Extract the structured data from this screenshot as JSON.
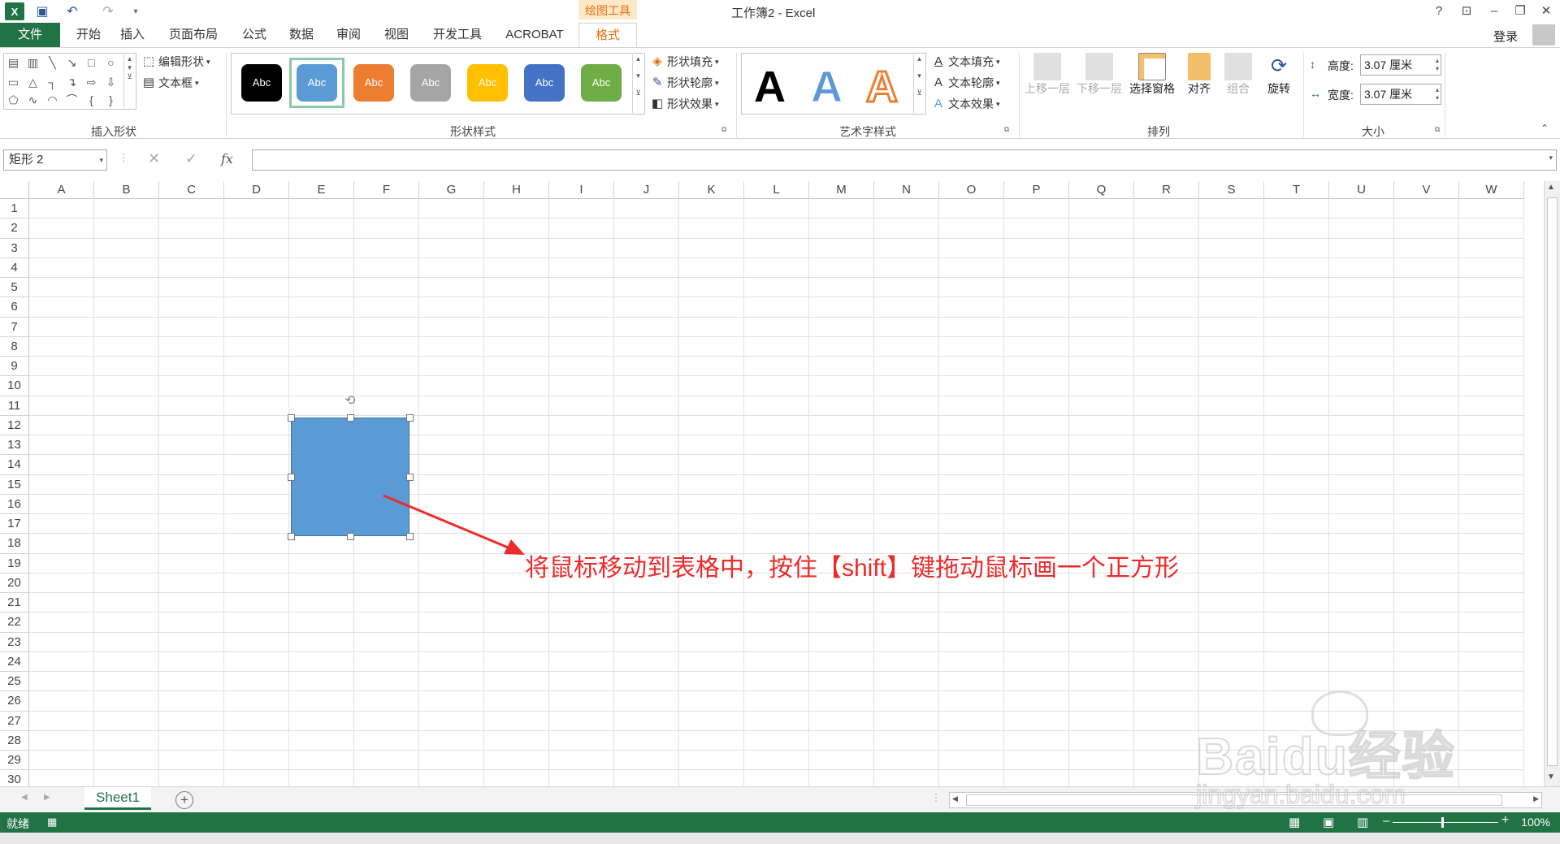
{
  "window": {
    "title": "工作簿2 - Excel",
    "context_group": "绘图工具"
  },
  "tabs": [
    "文件",
    "开始",
    "插入",
    "页面布局",
    "公式",
    "数据",
    "审阅",
    "视图",
    "开发工具",
    "ACROBAT",
    "格式"
  ],
  "account": {
    "login": "登录"
  },
  "ribbon": {
    "insert_shapes": {
      "label": "插入形状",
      "edit_shape": "编辑形状",
      "text_box": "文本框"
    },
    "shape_styles": {
      "label": "形状样式",
      "swatch_text": "Abc",
      "swatches": [
        {
          "color": "#000000"
        },
        {
          "color": "#5b9bd5"
        },
        {
          "color": "#ed7d31"
        },
        {
          "color": "#a5a5a5"
        },
        {
          "color": "#ffc000"
        },
        {
          "color": "#4472c4"
        },
        {
          "color": "#70ad47"
        }
      ],
      "fill": "形状填充",
      "outline": "形状轮廓",
      "effects": "形状效果"
    },
    "wordart": {
      "label": "艺术字样式",
      "glyph": "A",
      "text_fill": "文本填充",
      "text_outline": "文本轮廓",
      "text_effects": "文本效果"
    },
    "arrange": {
      "label": "排列",
      "bring_forward": "上移一层",
      "send_backward": "下移一层",
      "selection_pane": "选择窗格",
      "align": "对齐",
      "group": "组合",
      "rotate": "旋转"
    },
    "size": {
      "label": "大小",
      "height_label": "高度:",
      "height_value": "3.07 厘米",
      "width_label": "宽度:",
      "width_value": "3.07 厘米"
    }
  },
  "formula_bar": {
    "name_box": "矩形 2",
    "fx": "fx",
    "value": ""
  },
  "grid": {
    "columns": [
      "A",
      "B",
      "C",
      "D",
      "E",
      "F",
      "G",
      "H",
      "I",
      "J",
      "K",
      "L",
      "M",
      "N",
      "O",
      "P",
      "Q",
      "R",
      "S",
      "T",
      "U",
      "V",
      "W"
    ],
    "rows": [
      "1",
      "2",
      "3",
      "4",
      "5",
      "6",
      "7",
      "8",
      "9",
      "10",
      "11",
      "12",
      "13",
      "14",
      "15",
      "16",
      "17",
      "18",
      "19",
      "20",
      "21",
      "22",
      "23",
      "24",
      "25",
      "26",
      "27",
      "28",
      "29",
      "30"
    ]
  },
  "annotation": "将鼠标移动到表格中，按住【shift】键拖动鼠标画一个正方形",
  "sheets": [
    "Sheet1"
  ],
  "status": {
    "ready": "就绪",
    "zoom": "100%"
  },
  "watermark": {
    "logo": "Baidu经验",
    "url": "jingyan.baidu.com"
  },
  "colors": {
    "excel_green": "#217346",
    "shape_fill": "#5b9bd5",
    "annotation_red": "#ee2b2b",
    "context_orange": "#e87012"
  }
}
